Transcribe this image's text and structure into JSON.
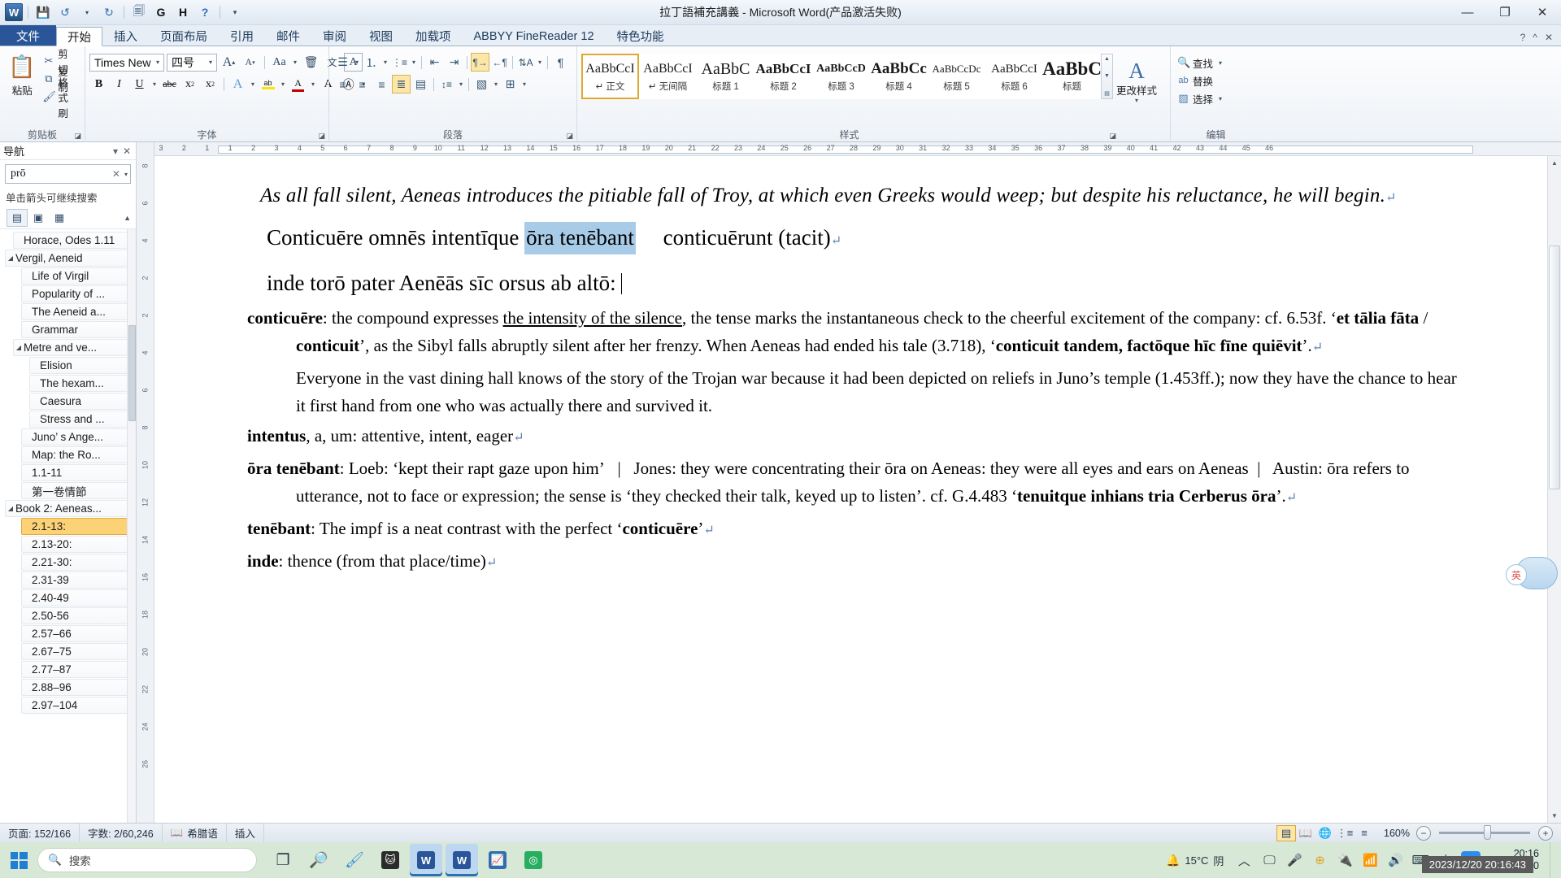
{
  "window": {
    "title": "拉丁語補充講義 - Microsoft Word(产品激活失败)",
    "app_logo": "W",
    "minimize": "—",
    "maximize": "❐",
    "close": "✕"
  },
  "quick_access": [
    {
      "name": "save-icon",
      "glyph": "💾"
    },
    {
      "name": "undo-icon",
      "glyph": "↺"
    },
    {
      "name": "undo-dropdown-icon",
      "glyph": "▾"
    },
    {
      "name": "redo-icon",
      "glyph": "↻"
    },
    {
      "name": "print-preview-icon",
      "glyph": "🗐"
    },
    {
      "name": "g-icon",
      "glyph": "G"
    },
    {
      "name": "h-icon",
      "glyph": "H"
    },
    {
      "name": "help-icon",
      "glyph": "?"
    },
    {
      "name": "customize-qat-icon",
      "glyph": "▾"
    }
  ],
  "tabs": [
    {
      "label": "文件",
      "kind": "file"
    },
    {
      "label": "开始",
      "kind": "active"
    },
    {
      "label": "插入",
      "kind": "normal"
    },
    {
      "label": "页面布局",
      "kind": "normal"
    },
    {
      "label": "引用",
      "kind": "normal"
    },
    {
      "label": "邮件",
      "kind": "normal"
    },
    {
      "label": "审阅",
      "kind": "normal"
    },
    {
      "label": "视图",
      "kind": "normal"
    },
    {
      "label": "加载项",
      "kind": "normal"
    },
    {
      "label": "ABBYY FineReader 12",
      "kind": "normal"
    },
    {
      "label": "特色功能",
      "kind": "normal"
    }
  ],
  "ribbon_right": [
    {
      "name": "help-small-icon",
      "glyph": "?"
    },
    {
      "name": "ribbon-collapse-icon",
      "glyph": "^"
    },
    {
      "name": "ribbon-close-icon",
      "glyph": "✕"
    }
  ],
  "ribbon": {
    "clipboard": {
      "label": "剪贴板",
      "paste_label": "粘贴",
      "paste_icon": "📋",
      "items": [
        {
          "label": "剪切",
          "icon": "✂"
        },
        {
          "label": "复制",
          "icon": "⧉"
        },
        {
          "label": "格式刷",
          "icon": "🖌"
        }
      ]
    },
    "font": {
      "label": "字体",
      "font_name": "Times New R",
      "font_size": "四号",
      "buttons": [
        {
          "name": "grow-font-icon",
          "glyph": "A▴"
        },
        {
          "name": "shrink-font-icon",
          "glyph": "A▾"
        },
        {
          "name": "change-case-icon",
          "glyph": "Aa"
        },
        {
          "name": "clear-formatting-icon",
          "glyph": "🗑"
        },
        {
          "name": "phonetic-guide-icon",
          "glyph": "文"
        },
        {
          "name": "character-border-icon",
          "glyph": "A"
        },
        {
          "name": "bold-icon",
          "glyph": "B"
        },
        {
          "name": "italic-icon",
          "glyph": "I"
        },
        {
          "name": "underline-icon",
          "glyph": "U"
        },
        {
          "name": "strikethrough-icon",
          "glyph": "abc"
        },
        {
          "name": "subscript-icon",
          "glyph": "x₂"
        },
        {
          "name": "superscript-icon",
          "glyph": "x²"
        },
        {
          "name": "text-effects-icon",
          "glyph": "A"
        },
        {
          "name": "highlight-icon",
          "glyph": "ab"
        },
        {
          "name": "font-color-icon",
          "glyph": "A"
        },
        {
          "name": "character-shading-icon",
          "glyph": "A"
        },
        {
          "name": "enclose-character-icon",
          "glyph": "Ⓐ"
        }
      ]
    },
    "paragraph": {
      "label": "段落",
      "buttons": [
        {
          "name": "bullets-icon",
          "glyph": "☰"
        },
        {
          "name": "numbering-icon",
          "glyph": "⒈"
        },
        {
          "name": "multilevel-list-icon",
          "glyph": "⋮≡"
        },
        {
          "name": "decrease-indent-icon",
          "glyph": "⇤"
        },
        {
          "name": "increase-indent-icon",
          "glyph": "⇥"
        },
        {
          "name": "ltr-text-icon",
          "glyph": "¶→"
        },
        {
          "name": "rtl-text-icon",
          "glyph": "←¶"
        },
        {
          "name": "sort-icon",
          "glyph": "A↓"
        },
        {
          "name": "show-formatting-marks-icon",
          "glyph": "¶"
        },
        {
          "name": "align-left-icon",
          "glyph": "≡"
        },
        {
          "name": "align-center-icon",
          "glyph": "≡"
        },
        {
          "name": "align-right-icon",
          "glyph": "≡"
        },
        {
          "name": "justify-icon",
          "glyph": "≣"
        },
        {
          "name": "distribute-icon",
          "glyph": "▤"
        },
        {
          "name": "line-spacing-icon",
          "glyph": "↕≡"
        },
        {
          "name": "shading-icon",
          "glyph": "▧"
        },
        {
          "name": "borders-icon",
          "glyph": "⊞"
        }
      ]
    },
    "styles": {
      "label": "样式",
      "gallery": [
        {
          "sample": "AaBbCcI",
          "name": "↵ 正文",
          "selected": true,
          "weight": "normal",
          "size": "16px"
        },
        {
          "sample": "AaBbCcI",
          "name": "↵ 无间隔",
          "selected": false,
          "weight": "normal",
          "size": "16px"
        },
        {
          "sample": "AaBbC",
          "name": "标题 1",
          "selected": false,
          "weight": "normal",
          "size": "20px"
        },
        {
          "sample": "AaBbCcI",
          "name": "标题 2",
          "selected": false,
          "weight": "bold",
          "size": "17px"
        },
        {
          "sample": "AaBbCcD",
          "name": "标题 3",
          "selected": false,
          "weight": "bold",
          "size": "14px"
        },
        {
          "sample": "AaBbCc",
          "name": "标题 4",
          "selected": false,
          "weight": "bold",
          "size": "19px"
        },
        {
          "sample": "AaBbCcDc",
          "name": "标题 5",
          "selected": false,
          "weight": "normal",
          "size": "13px"
        },
        {
          "sample": "AaBbCcI",
          "name": "标题 6",
          "selected": false,
          "weight": "normal",
          "size": "15px"
        },
        {
          "sample": "AaBbC",
          "name": "标题",
          "selected": false,
          "weight": "bold",
          "size": "23px"
        }
      ],
      "change_styles_label": "更改样式",
      "change_styles_icon": "A"
    },
    "editing": {
      "label": "编辑",
      "items": [
        {
          "label": "查找",
          "icon": "🔍"
        },
        {
          "label": "替换",
          "icon": "ab"
        },
        {
          "label": "选择",
          "icon": "▨"
        }
      ]
    }
  },
  "navigation": {
    "title": "导航",
    "collapse_icon": "▾",
    "close_icon": "✕",
    "search_value": "prō",
    "search_clear_icon": "✕",
    "search_dropdown_icon": "▾",
    "hint": "单击箭头可继续搜索",
    "view_tabs": [
      {
        "name": "headings-tab-icon",
        "glyph": "▤",
        "active": true
      },
      {
        "name": "pages-tab-icon",
        "glyph": "▣",
        "active": false
      },
      {
        "name": "results-tab-icon",
        "glyph": "▦",
        "active": false
      }
    ],
    "collapse_arrow_icon": "▲",
    "items": [
      {
        "label": "Horace, Odes 1.11",
        "indent": 1,
        "arrow": "",
        "selected": false
      },
      {
        "label": "Vergil, Aeneid",
        "indent": 0,
        "arrow": "◢",
        "selected": false
      },
      {
        "label": "Life of Virgil",
        "indent": 2,
        "arrow": "",
        "selected": false
      },
      {
        "label": "Popularity of ...",
        "indent": 2,
        "arrow": "",
        "selected": false
      },
      {
        "label": "The Aeneid a...",
        "indent": 2,
        "arrow": "",
        "selected": false
      },
      {
        "label": "Grammar",
        "indent": 2,
        "arrow": "",
        "selected": false
      },
      {
        "label": "Metre and ve...",
        "indent": 1,
        "arrow": "◢",
        "selected": false
      },
      {
        "label": "Elision",
        "indent": 3,
        "arrow": "",
        "selected": false
      },
      {
        "label": "The hexam...",
        "indent": 3,
        "arrow": "",
        "selected": false
      },
      {
        "label": "Caesura",
        "indent": 3,
        "arrow": "",
        "selected": false
      },
      {
        "label": "Stress and ...",
        "indent": 3,
        "arrow": "",
        "selected": false
      },
      {
        "label": "Juno’ s Ange...",
        "indent": 2,
        "arrow": "",
        "selected": false
      },
      {
        "label": "Map: the Ro...",
        "indent": 2,
        "arrow": "",
        "selected": false
      },
      {
        "label": "1.1-11",
        "indent": 2,
        "arrow": "",
        "selected": false
      },
      {
        "label": "第一卷情節",
        "indent": 2,
        "arrow": "",
        "selected": false
      },
      {
        "label": "Book 2: Aeneas...",
        "indent": 0,
        "arrow": "◢",
        "selected": false
      },
      {
        "label": "2.1-13:",
        "indent": 2,
        "arrow": "",
        "selected": true
      },
      {
        "label": "2.13-20:",
        "indent": 2,
        "arrow": "",
        "selected": false
      },
      {
        "label": "2.21-30:",
        "indent": 2,
        "arrow": "",
        "selected": false
      },
      {
        "label": "2.31-39",
        "indent": 2,
        "arrow": "",
        "selected": false
      },
      {
        "label": "2.40-49",
        "indent": 2,
        "arrow": "",
        "selected": false
      },
      {
        "label": "2.50-56",
        "indent": 2,
        "arrow": "",
        "selected": false
      },
      {
        "label": "2.57–66",
        "indent": 2,
        "arrow": "",
        "selected": false
      },
      {
        "label": "2.67–75",
        "indent": 2,
        "arrow": "",
        "selected": false
      },
      {
        "label": "2.77–87",
        "indent": 2,
        "arrow": "",
        "selected": false
      },
      {
        "label": "2.88–96",
        "indent": 2,
        "arrow": "",
        "selected": false
      },
      {
        "label": "2.97–104",
        "indent": 2,
        "arrow": "",
        "selected": false
      }
    ]
  },
  "ruler": {
    "horizontal": [
      "3",
      "2",
      "1",
      "1",
      "2",
      "3",
      "4",
      "5",
      "6",
      "7",
      "8",
      "9",
      "10",
      "11",
      "12",
      "13",
      "14",
      "15",
      "16",
      "17",
      "18",
      "19",
      "20",
      "21",
      "22",
      "23",
      "24",
      "25",
      "26",
      "27",
      "28",
      "29",
      "30",
      "31",
      "32",
      "33",
      "34",
      "35",
      "36",
      "37",
      "38",
      "39",
      "40",
      "41",
      "42",
      "43",
      "44",
      "45",
      "46"
    ],
    "vertical": [
      "8",
      "6",
      "4",
      "2",
      "2",
      "4",
      "6",
      "8",
      "10",
      "12",
      "14",
      "16",
      "18",
      "20",
      "22",
      "24",
      "26"
    ]
  },
  "document": {
    "intro": "As all fall silent, Aeneas introduces the pitiable fall of Troy, at which even Greeks would weep; but despite his reluctance, he will begin.",
    "latin_line_1a": "Conticuēre omnēs intentīque ",
    "latin_line_1_highlight": "ōra tenēbant",
    "latin_line_1b": "     conticuērunt (tacit)",
    "latin_line_2": "inde torō pater Aenēās sīc orsus ab altō:",
    "notes": [
      {
        "lemma": "conticuēre",
        "html": ": the compound expresses <u>the intensity of the silence</u>, the tense marks the instantaneous check to the cheerful excitement of the company: cf. 6.53f. ‘<b>et tālia fāta</b> / <b>conticuit</b>’, as the Sibyl falls abruptly silent after her frenzy. When Aeneas had ended his tale (3.718), ‘<b>conticuit tandem, factōque hīc fīne quiēvit</b>’."
      },
      {
        "lemma": "",
        "html": "Everyone in the vast dining hall knows of the story of the Trojan war because it had been depicted on reliefs in Juno’s temple (1.453ff.); now they have the chance to hear it first hand from one who was actually there and survived it."
      },
      {
        "lemma": "intentus",
        "html": ", a, um: attentive, intent, eager"
      },
      {
        "lemma": "ōra tenēbant",
        "html": ": Loeb: ‘kept their rapt gaze upon him’&nbsp;&nbsp;&nbsp;|&nbsp;&nbsp; Jones: they were concentrating their ōra on Aeneas: they were all eyes and ears on Aeneas&nbsp;&nbsp;|&nbsp;&nbsp; Austin: ōra refers to utterance, not to face or expression; the sense is ‘they checked their talk, keyed up to listen’. cf. G.4.483 ‘<b>tenuitque inhians tria Cerberus ōra</b>’."
      },
      {
        "lemma": "tenēbant",
        "html": ": The impf is a neat contrast with the perfect ‘<b>conticuēre</b>’"
      },
      {
        "lemma": "inde",
        "html": ": thence (from that place/time)"
      }
    ]
  },
  "status_bar": {
    "page": "页面: 152/166",
    "words": "字数: 2/60,246",
    "proofing_icon": "📖",
    "language": "希腊语",
    "insert_mode": "插入",
    "view_buttons": [
      {
        "name": "print-layout-view-icon",
        "glyph": "▤",
        "active": true
      },
      {
        "name": "full-screen-reading-view-icon",
        "glyph": "📖",
        "active": false
      },
      {
        "name": "web-layout-view-icon",
        "glyph": "🌐",
        "active": false
      },
      {
        "name": "outline-view-icon",
        "glyph": "⋮≡",
        "active": false
      },
      {
        "name": "draft-view-icon",
        "glyph": "≡",
        "active": false
      }
    ],
    "zoom_level": "160%",
    "zoom_out_icon": "−",
    "zoom_in_icon": "+"
  },
  "taskbar": {
    "start_icon": "windows-logo",
    "search_placeholder": "搜索",
    "search_icon": "🔍",
    "apps": [
      {
        "name": "task-view-icon",
        "glyph": "❐",
        "active": false,
        "color": "#2c3e50"
      },
      {
        "name": "cortana-icon",
        "glyph": "◯",
        "active": false,
        "color": "#2f86c5"
      },
      {
        "name": "edge-browser-icon",
        "glyph": "e",
        "active": false,
        "color": "#3b8fd4"
      },
      {
        "name": "cat-app-icon",
        "glyph": "🐱",
        "active": false,
        "color": "#2b2b2b"
      },
      {
        "name": "word-taskbar-icon-1",
        "glyph": "W",
        "active": true,
        "color": "#2a5699"
      },
      {
        "name": "word-taskbar-icon-2",
        "glyph": "W",
        "active": true,
        "color": "#2a5699"
      },
      {
        "name": "chart-app-icon",
        "glyph": "📈",
        "active": false,
        "color": "#2f6fb0"
      },
      {
        "name": "recorder-app-icon",
        "glyph": "◎",
        "active": false,
        "color": "#27ae60"
      }
    ],
    "weather_temp": "15°C",
    "weather_desc": "阴",
    "tray": [
      {
        "name": "show-hidden-icons-icon",
        "glyph": "^"
      },
      {
        "name": "screen-share-icon",
        "glyph": "🖵"
      },
      {
        "name": "microphone-icon",
        "glyph": "🎤"
      },
      {
        "name": "update-icon",
        "glyph": "⊕"
      },
      {
        "name": "battery-icon",
        "glyph": "🔋"
      },
      {
        "name": "wifi-icon",
        "glyph": "📶"
      },
      {
        "name": "volume-icon",
        "glyph": "🔊"
      },
      {
        "name": "keyboard-icon",
        "glyph": "⌨"
      },
      {
        "name": "ime-icon",
        "glyph": "中"
      },
      {
        "name": "qq-icon",
        "glyph": "Q"
      }
    ],
    "clock_time": "20:16",
    "clock_date": "2023/12/20",
    "clock_tooltip": "2023/12/20 20:16:43"
  }
}
